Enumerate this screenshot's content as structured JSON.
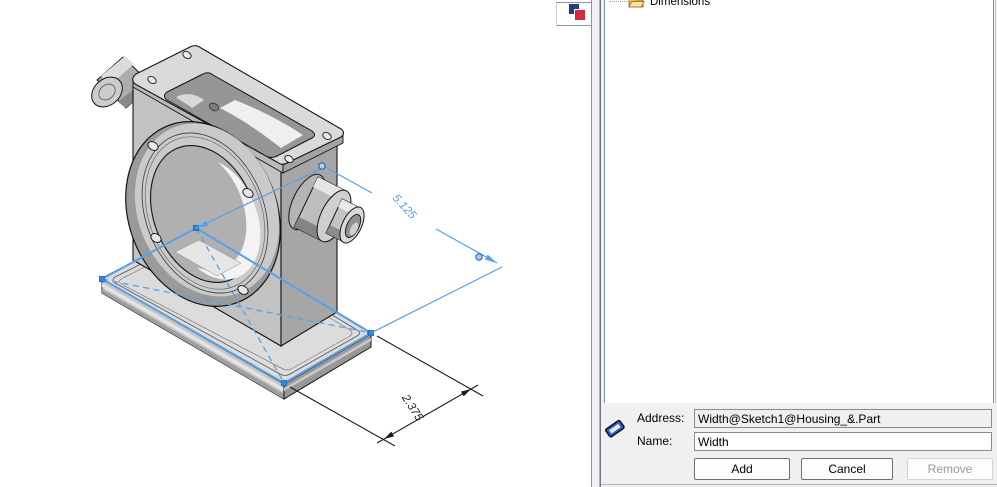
{
  "graphics": {
    "selection_color": "#57a0e8",
    "dim_diagonal": "5.125",
    "dim_width": "2.375"
  },
  "side_tabs": {
    "active_icon": "overlapping-squares"
  },
  "panel": {
    "tree": {
      "items": [
        {
          "label": "Dimensions",
          "icon": "folder-icon"
        }
      ]
    },
    "form": {
      "address_label": "Address:",
      "address_value": "Width@Sketch1@Housing_&.Part",
      "name_label": "Name:",
      "name_value": "Width",
      "buttons": [
        {
          "label": "Add",
          "enabled": true
        },
        {
          "label": "Cancel",
          "enabled": true
        },
        {
          "label": "Remove",
          "enabled": false
        }
      ]
    }
  }
}
